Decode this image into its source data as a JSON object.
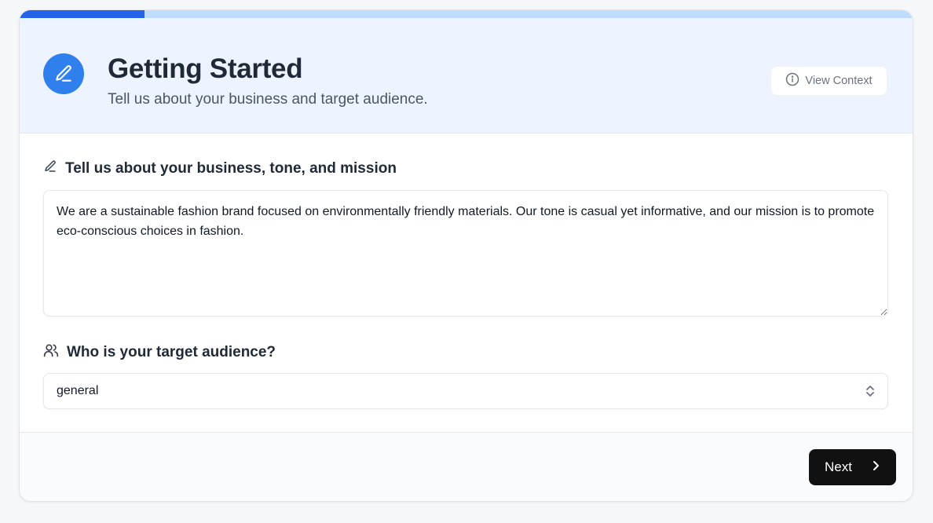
{
  "progress": {
    "fraction": 0.14
  },
  "header": {
    "title": "Getting Started",
    "subtitle": "Tell us about your business and target audience.",
    "context_button": "View Context",
    "icon": "pencil-icon"
  },
  "form": {
    "business": {
      "label": "Tell us about your business, tone, and mission",
      "value": "We are a sustainable fashion brand focused on environmentally friendly materials. Our tone is casual yet informative, and our mission is to promote eco-conscious choices in fashion.",
      "icon": "pencil-icon"
    },
    "audience": {
      "label": "Who is your target audience?",
      "selected": "general",
      "icon": "users-icon"
    }
  },
  "footer": {
    "next_label": "Next"
  },
  "colors": {
    "accent": "#2563eb",
    "header_bg": "#eef4ff",
    "button_dark": "#111111"
  }
}
